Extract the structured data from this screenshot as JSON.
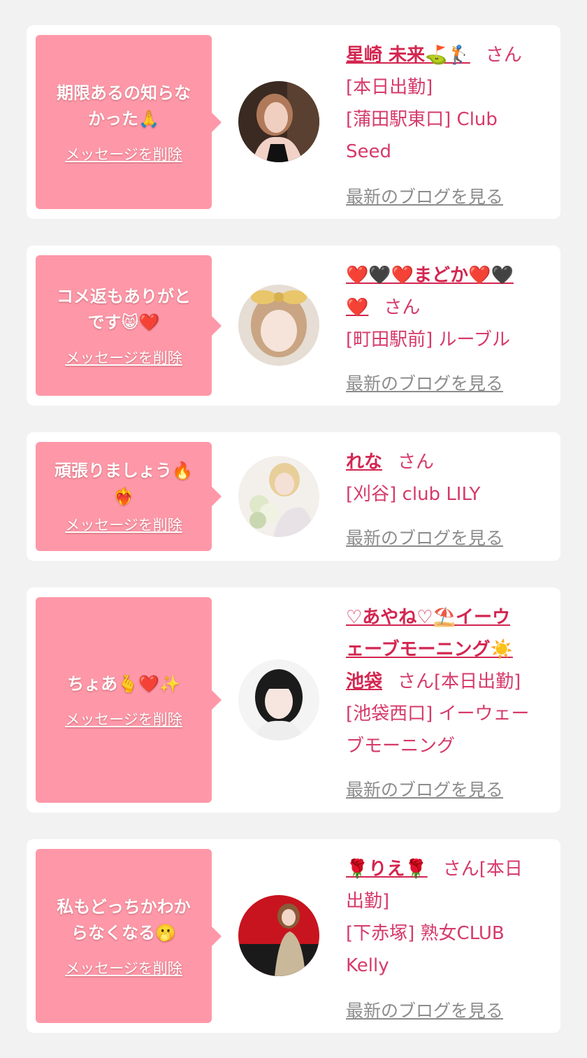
{
  "delete_label": "メッセージを削除",
  "blog_label": "最新のブログを見る",
  "honorific": "さん",
  "colors": {
    "bubble": "#fe98a8",
    "name": "#d32650",
    "text": "#d63a6a",
    "link": "#8c8c8c",
    "background": "#f2f2f2"
  },
  "messages": [
    {
      "message_line1": "期限あるの知らな",
      "message_line2": "かった",
      "message_emoji": "🙏",
      "name": "星崎 未来⛳🏌",
      "after_san": "",
      "line1": "[本日出勤]",
      "line2": "[蒲田駅東口] Club",
      "line3": "Seed",
      "avatar_icon": "user-photo"
    },
    {
      "message_line1": "コメ返もありがと",
      "message_line2": "です",
      "message_emoji": "😸❤️",
      "name_line1": "❤️🖤❤️まどか❤️🖤",
      "name_line2": "❤️",
      "line1": "[町田駅前] ルーブル",
      "avatar_icon": "user-photo"
    },
    {
      "message_line1": "頑張りましょう🔥",
      "message_line2": "",
      "message_emoji": "❤️‍🔥",
      "name": "れな",
      "line1": "[刈谷] club LILY",
      "avatar_icon": "user-photo"
    },
    {
      "message_line1": "ちょあ",
      "message_line2": "",
      "message_emoji": "🫰❤️✨",
      "name_line1": "♡あやね♡⛱️イーウ",
      "name_line2": "ェーブモーニング☀️",
      "name_line3": "池袋",
      "after_san": "[本日出勤]",
      "line1": "[池袋西口] イーウェー",
      "line2": "ブモーニング",
      "avatar_icon": "user-photo"
    },
    {
      "message_line1": "私もどっちかわか",
      "message_line2": "らなくなる",
      "message_emoji": "🫢",
      "name": "🌹りえ🌹",
      "after_san": "[本日",
      "line1": "出勤]",
      "line2": "[下赤塚] 熟女CLUB",
      "line3": "Kelly",
      "avatar_icon": "user-photo"
    }
  ]
}
